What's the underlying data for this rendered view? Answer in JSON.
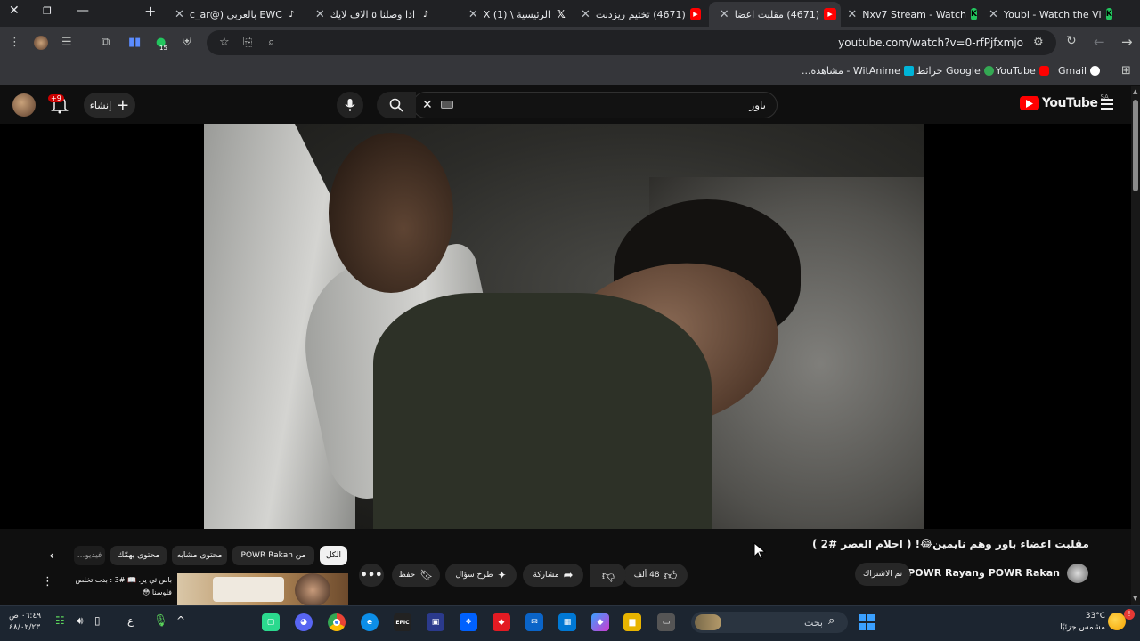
{
  "browser": {
    "tabs": [
      {
        "title": "Youbi - Watch the Vi",
        "favicon": "green-k"
      },
      {
        "title": "Nxv7 Stream - Watch",
        "favicon": "green-k"
      },
      {
        "title": "(4671) مقلبت اعضا",
        "favicon": "youtube",
        "active": true
      },
      {
        "title": "(4671) تختيم ريزدنت",
        "favicon": "youtube"
      },
      {
        "title": "الرئيسية \\ X (1)",
        "favicon": "x"
      },
      {
        "title": "اذا وصلنا ٥ الاف لايك",
        "favicon": "tiktok"
      },
      {
        "title": "EWC بالعربي (@c_ar",
        "favicon": "tiktok"
      }
    ],
    "url": "youtube.com/watch?v=0-rfPjfxmjo",
    "extension_badge": "15",
    "bookmarks": [
      {
        "label": "Gmail",
        "icon": "google-g"
      },
      {
        "label": "YouTube",
        "icon": "youtube"
      },
      {
        "label": "Google خرائط",
        "icon": "maps-pin"
      },
      {
        "label": "WitAnime - مشاهدة...",
        "icon": "witanime"
      }
    ]
  },
  "youtube": {
    "logo_text": "YouTube",
    "country_code": "SA",
    "search_value": "باور",
    "create_label": "إنشاء",
    "notification_badge": "+9",
    "video": {
      "title": "مقلبت اعضاء باور وهم نايمين😂! ( احلام العصر #2 )",
      "channel": "POWR Rakan وPOWR Rayan",
      "subscribe_label": "تم الاشتراك",
      "likes": "48 ألف",
      "share_label": "مشاركة",
      "ask_label": "طرح سؤال",
      "save_label": "حفظ"
    },
    "chips": [
      "الكل",
      "من POWR Rakan",
      "محتوى مشابه",
      "محتوى يهمّك",
      "فيديو..."
    ],
    "recommendation": {
      "title": "باص ثي ير. 📖 #3 : بدت تخلص فلوسنا 😳",
      "channel": "..."
    }
  },
  "taskbar": {
    "search_placeholder": "بحث",
    "language": "ع",
    "time": "٠٦:٤٩ ص",
    "date": "٤٨/٠٢/٢٣",
    "weather_temp": "33°C",
    "weather_desc": "مشمس جزئيًا"
  },
  "colors": {
    "youtube_red": "#ff0000",
    "chrome_dark": "#202124",
    "chrome_toolbar": "#35363a",
    "yt_bg": "#0f0f0f",
    "taskbar": "#1c2530"
  }
}
